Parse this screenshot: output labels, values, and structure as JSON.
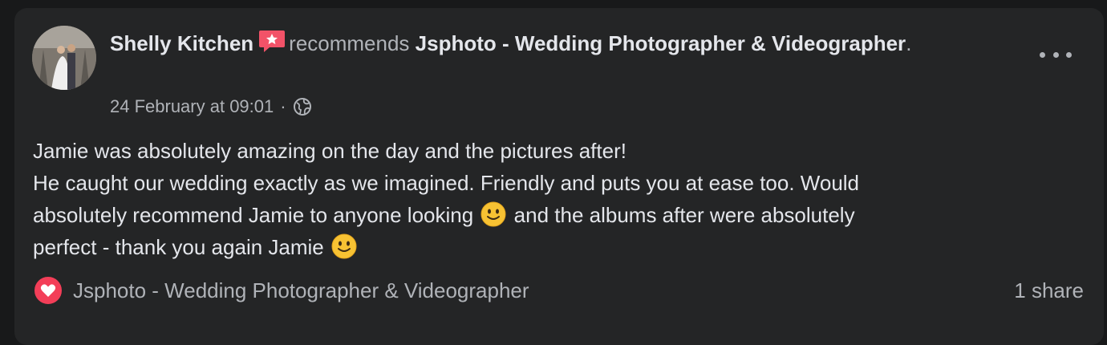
{
  "post": {
    "author": "Shelly Kitchen",
    "recommends_text": "recommends",
    "page_name": "Jsphoto - Wedding Photographer & Videographer",
    "period": ".",
    "timestamp": "24 February at 09:01",
    "separator": "·",
    "body_line1": "Jamie was absolutely amazing on the day and the pictures after!",
    "body_line2": "He caught our wedding exactly as we imagined. Friendly and puts you at ease too. Would",
    "body_line3a": "absolutely recommend Jamie to anyone looking",
    "body_line3b": "and the albums after were absolutely",
    "body_line4": "perfect - thank you again Jamie",
    "emoji": "smiling-face-emoji"
  },
  "footer": {
    "reaction_icon": "heart-icon",
    "recommended_page": "Jsphoto - Wedding Photographer & Videographer",
    "shares": "1 share"
  },
  "icons": {
    "recommendation": "recommendation-star-icon",
    "privacy": "globe-icon",
    "more": "more-options-icon"
  },
  "colors": {
    "background": "#242526",
    "text_primary": "#e4e6eb",
    "text_secondary": "#b0b3b8",
    "recommend_red": "#f25268",
    "heart_red": "#f33e58"
  }
}
